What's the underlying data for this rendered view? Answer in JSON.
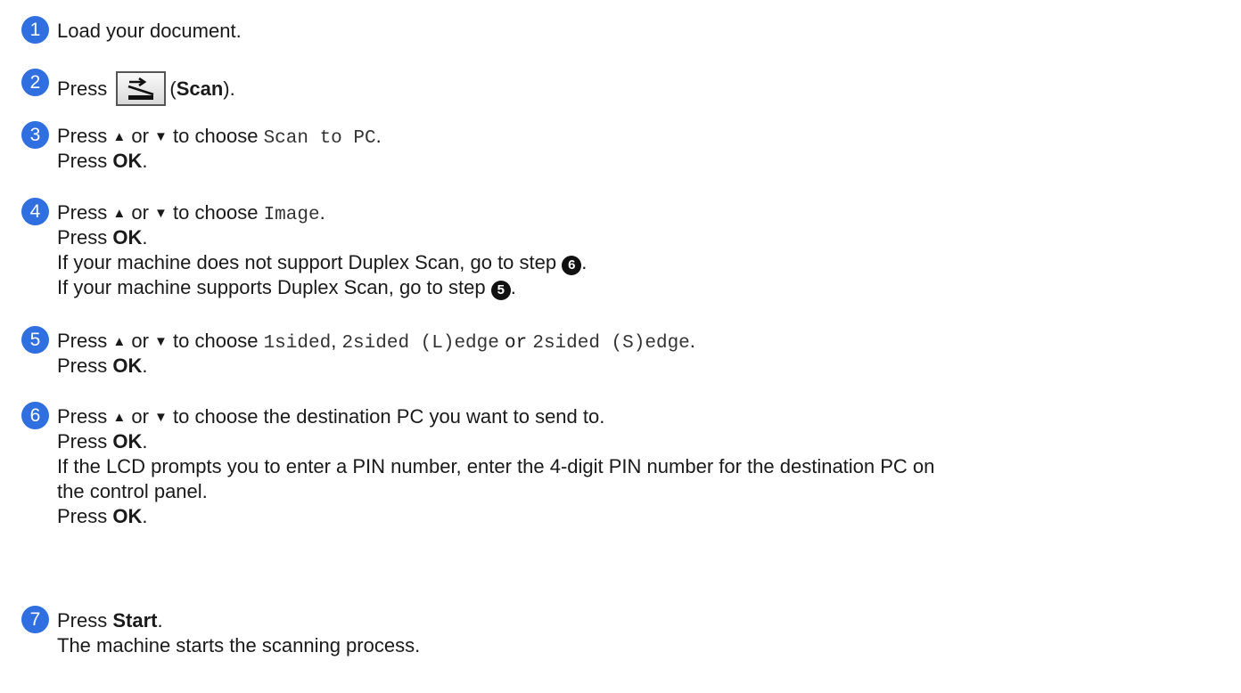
{
  "steps": [
    {
      "number": "1",
      "text": "Load your document."
    },
    {
      "number": "2",
      "press": "Press",
      "key_name": "Scan",
      "open": "(",
      "close": ")."
    },
    {
      "number": "3",
      "press": "Press",
      "or": "or",
      "to_choose": "to choose",
      "option": "Scan to PC",
      "dot": ".",
      "press_ok": "Press",
      "ok": "OK"
    },
    {
      "number": "4",
      "press": "Press",
      "or": "or",
      "to_choose": "to choose",
      "option": "Image",
      "dot": ".",
      "press_ok": "Press",
      "ok": "OK",
      "line3": "If your machine does not support Duplex Scan, go to step",
      "ref3": "6",
      "line4": "If your machine supports Duplex Scan, go to step",
      "ref4": "5"
    },
    {
      "number": "5",
      "press": "Press",
      "or": "or",
      "to_choose": "to choose",
      "option1": "1sided",
      "comma": ",",
      "option2": "2sided (L)edge",
      "or2": "or",
      "option3": "2sided (S)edge",
      "dot": ".",
      "press_ok": "Press",
      "ok": "OK"
    },
    {
      "number": "6",
      "press": "Press",
      "or": "or",
      "text": "to choose the destination PC you want to send to.",
      "press_ok": "Press",
      "ok": "OK",
      "line3": "If the LCD prompts you to enter a PIN number, enter the 4-digit PIN number for the destination PC on",
      "line4": "the control panel.",
      "press_ok2": "Press",
      "ok2": "OK"
    },
    {
      "number": "7",
      "press": "Press",
      "key": "Start",
      "text": "The machine starts the scanning process."
    }
  ],
  "icons": {
    "up": "▲",
    "down": "▼",
    "scan_button_icon": "scan-key-icon"
  },
  "colors": {
    "badge": "#2f6fe0",
    "ref_badge": "#111111"
  }
}
